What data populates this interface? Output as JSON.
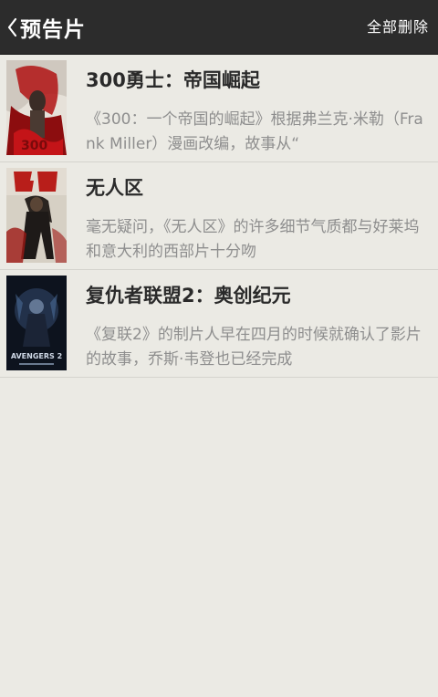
{
  "header": {
    "title": "预告片",
    "back_icon": "chevron-left-icon",
    "delete_all_label": "全部删除"
  },
  "trailers": [
    {
      "title": "300勇士：帝国崛起",
      "description": "《300：一个帝国的崛起》根据弗兰克·米勒（Frank Miller）漫画改编，故事从“",
      "poster_colors": [
        "#e8e3dc",
        "#b31214"
      ]
    },
    {
      "title": "无人区",
      "description": "毫无疑问，《无人区》的许多细节气质都与好莱坞和意大利的西部片十分吻",
      "poster_colors": [
        "#d8d2c7",
        "#b81e1a"
      ]
    },
    {
      "title": "复仇者联盟2：奥创纪元",
      "description": "《复联2》的制片人早在四月的时候就确认了影片的故事，乔斯·韦登也已经完成",
      "poster_colors": [
        "#0e1420",
        "#3b5a86"
      ]
    }
  ],
  "poster_texts": {
    "avengers_logo": "AVENGERS 2"
  },
  "colors": {
    "header_bg": "#2c2c2c",
    "page_bg": "#ebeae4",
    "title_text": "#2a2a2a",
    "desc_text": "#8e8e8e"
  }
}
